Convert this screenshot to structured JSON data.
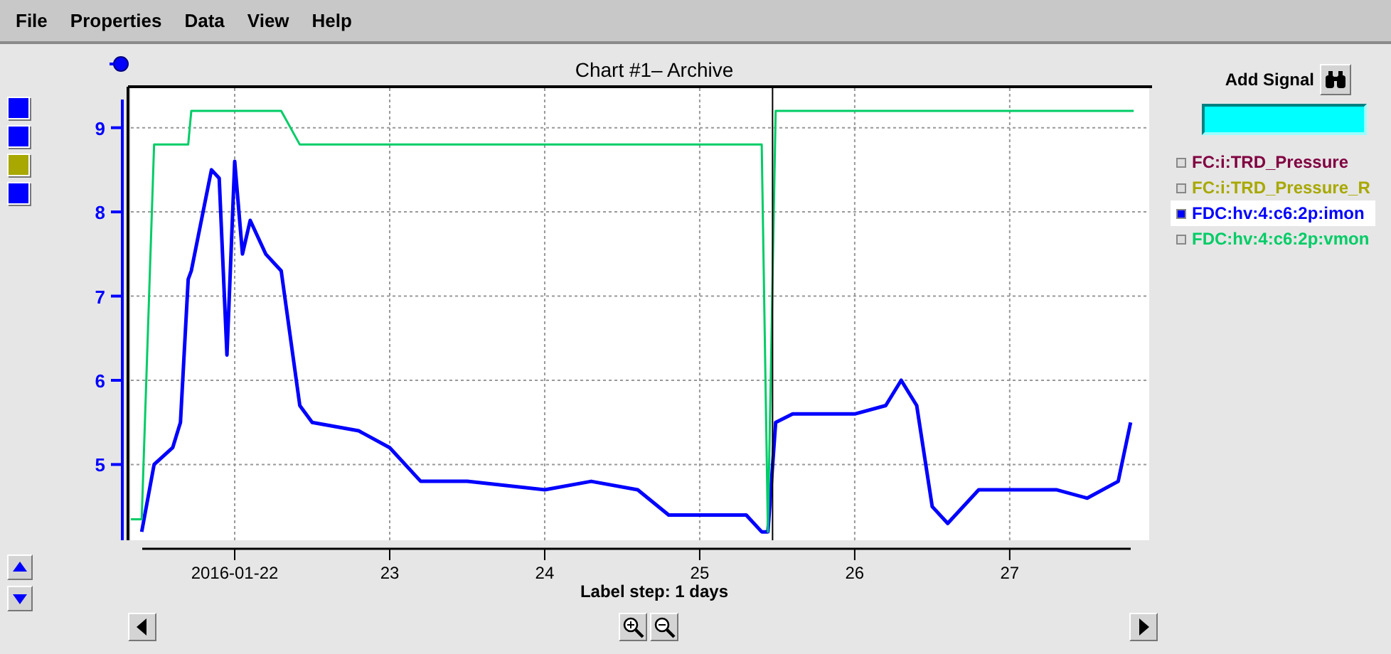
{
  "menu": [
    "File",
    "Properties",
    "Data",
    "View",
    "Help"
  ],
  "axis_buttons": [
    {
      "color": "#0000ff"
    },
    {
      "color": "#0000ff"
    },
    {
      "color": "#a8a800"
    },
    {
      "color": "#0000ff"
    }
  ],
  "chart": {
    "title": "Chart #1– Archive",
    "label_step": "Label step: 1 days",
    "chart_data": {
      "type": "line",
      "xlim": [
        21.33,
        27.9
      ],
      "ylim": [
        4.1,
        9.47
      ],
      "xticks": [
        {
          "value": 22,
          "label": "2016-01-22"
        },
        {
          "value": 23,
          "label": "23"
        },
        {
          "value": 24,
          "label": "24"
        },
        {
          "value": 25,
          "label": "25"
        },
        {
          "value": 26,
          "label": "26"
        },
        {
          "value": 27,
          "label": "27"
        }
      ],
      "yticks": [
        5,
        6,
        7,
        8,
        9
      ],
      "grid": true,
      "ref_lines": [
        {
          "axis": "x",
          "value": 25.47,
          "color": "#000000"
        }
      ],
      "x": [
        21.33,
        21.4,
        21.48,
        21.6,
        21.65,
        21.7,
        21.72,
        21.85,
        21.9,
        21.95,
        22.0,
        22.05,
        22.1,
        22.2,
        22.3,
        22.42,
        22.5,
        22.8,
        23.0,
        23.2,
        23.5,
        24.0,
        24.3,
        24.6,
        24.8,
        25.3,
        25.4,
        25.44,
        25.49,
        25.6,
        26.0,
        26.2,
        26.3,
        26.4,
        26.5,
        26.6,
        26.8,
        27.3,
        27.5,
        27.7,
        27.78,
        27.8
      ],
      "series": [
        {
          "name": "FDC:hv:4:c6:2p:imon",
          "color": "#0000ff",
          "values": [
            null,
            4.2,
            5.0,
            5.2,
            5.5,
            7.2,
            7.3,
            8.5,
            8.4,
            6.3,
            8.6,
            7.5,
            7.9,
            7.5,
            7.3,
            5.7,
            5.5,
            5.4,
            5.2,
            4.8,
            4.8,
            4.7,
            4.8,
            4.7,
            4.4,
            4.4,
            4.2,
            4.2,
            5.5,
            5.6,
            5.6,
            5.7,
            6.0,
            5.7,
            4.5,
            4.3,
            4.7,
            4.7,
            4.6,
            4.8,
            5.5,
            null
          ]
        },
        {
          "name": "FDC:hv:4:c6:2p:vmon",
          "color": "#00cc66",
          "values": [
            4.35,
            4.35,
            8.8,
            8.8,
            8.8,
            8.8,
            9.2,
            9.2,
            9.2,
            9.2,
            9.2,
            9.2,
            9.2,
            9.2,
            9.2,
            8.8,
            8.8,
            8.8,
            8.8,
            8.8,
            8.8,
            8.8,
            8.8,
            8.8,
            8.8,
            8.8,
            8.8,
            4.2,
            9.2,
            9.2,
            9.2,
            9.2,
            9.2,
            9.2,
            9.2,
            9.2,
            9.2,
            9.2,
            9.2,
            9.2,
            9.2,
            9.2
          ]
        }
      ]
    }
  },
  "add_signal": {
    "label": "Add Signal"
  },
  "legend": [
    {
      "name": "FC:i:TRD_Pressure",
      "color": "#800040",
      "selected": false
    },
    {
      "name": "FC:i:TRD_Pressure_R",
      "color": "#a8a800",
      "selected": false
    },
    {
      "selected": true
    },
    {
      "selected": false
    }
  ]
}
